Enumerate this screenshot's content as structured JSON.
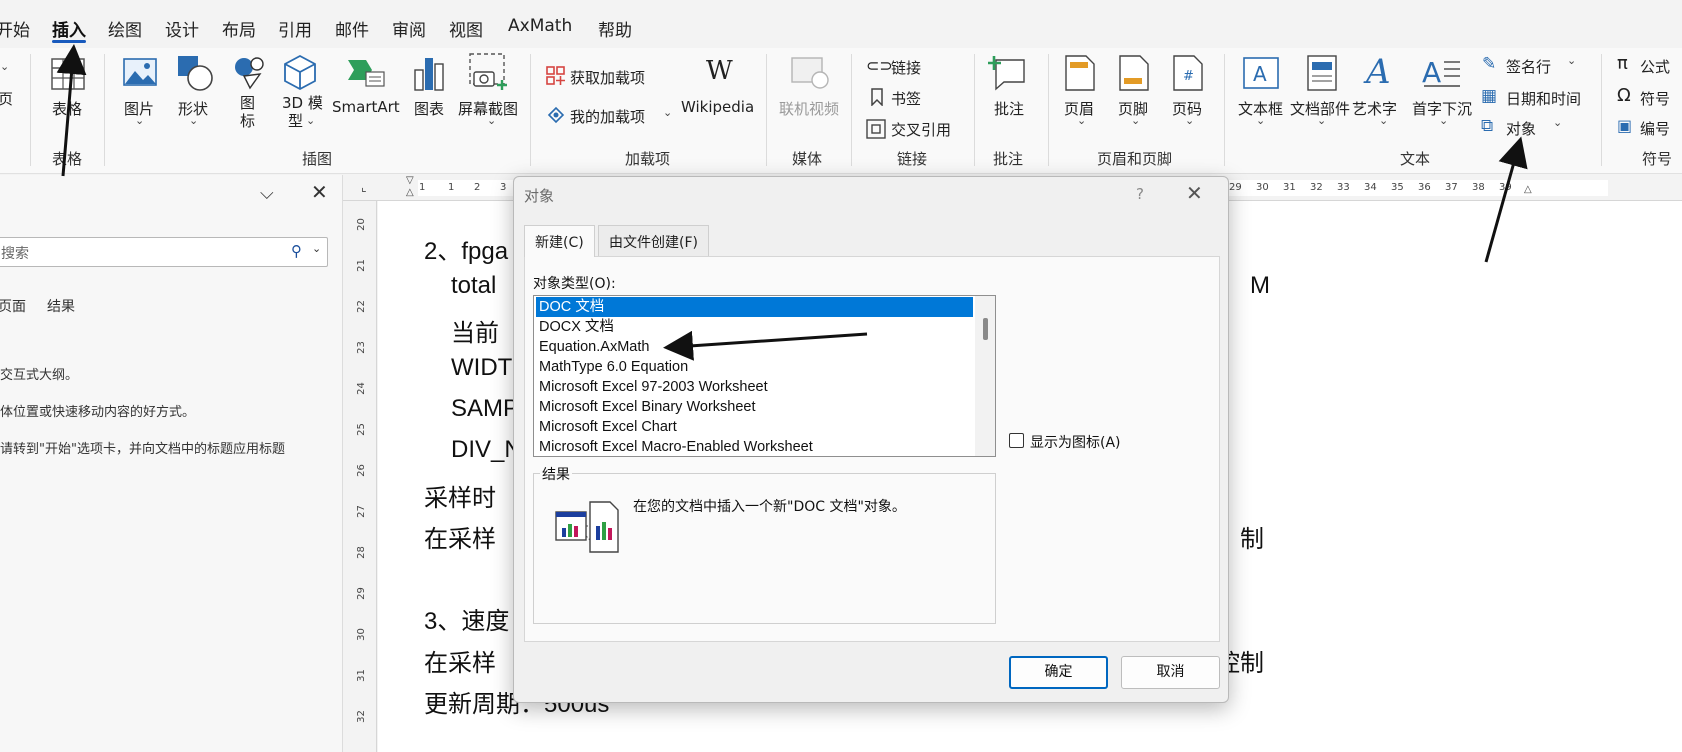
{
  "menu": {
    "tabs": [
      {
        "label": "开始"
      },
      {
        "label": "插入",
        "active": true
      },
      {
        "label": "绘图"
      },
      {
        "label": "设计"
      },
      {
        "label": "布局"
      },
      {
        "label": "引用"
      },
      {
        "label": "邮件"
      },
      {
        "label": "审阅"
      },
      {
        "label": "视图"
      },
      {
        "label": "AxMath"
      },
      {
        "label": "帮助"
      }
    ]
  },
  "ribbon": {
    "left_cut_label": "页",
    "groups": {
      "tables": {
        "label": "表格",
        "table_button": "表格"
      },
      "illustrations": {
        "label": "插图",
        "picture": "图片",
        "shapes": "形状",
        "icons_line1": "图",
        "icons_line2": "标",
        "model3d_line1": "3D 模",
        "model3d_line2": "型",
        "smartart": "SmartArt",
        "chart": "图表",
        "screenshot": "屏幕截图"
      },
      "addins": {
        "label": "加载项",
        "get_addins": "获取加载项",
        "my_addins": "我的加载项",
        "wikipedia": "Wikipedia"
      },
      "media": {
        "label": "媒体",
        "online_video": "联机视频"
      },
      "links": {
        "label": "链接",
        "link": "链接",
        "bookmark": "书签",
        "cross_reference": "交叉引用"
      },
      "comments": {
        "label": "批注",
        "comment": "批注"
      },
      "header_footer": {
        "label": "页眉和页脚",
        "header": "页眉",
        "footer": "页脚",
        "page_number": "页码"
      },
      "text": {
        "label": "文本",
        "textbox": "文本框",
        "quick_parts": "文档部件",
        "wordart": "艺术字",
        "drop_cap": "首字下沉",
        "signature_line": "签名行",
        "date_time": "日期和时间",
        "object": "对象"
      },
      "symbols": {
        "label": "符号",
        "equation": "公式",
        "symbol": "符号",
        "number": "编号"
      }
    }
  },
  "nav_pane": {
    "search_placeholder": "搜索",
    "tabs": [
      "页面",
      "结果"
    ],
    "hints": [
      "交互式大纲。",
      "体位置或快速移动内容的好方式。",
      "请转到\"开始\"选项卡，并向文档中的标题应用标题"
    ]
  },
  "ruler": {
    "top_numbers": [
      "1",
      "1",
      "2",
      "3",
      "29",
      "30",
      "31",
      "32",
      "33",
      "34",
      "35",
      "36",
      "37",
      "38",
      "39"
    ],
    "left_numbers": [
      "20",
      "21",
      "22",
      "23",
      "24",
      "25",
      "26",
      "27",
      "28",
      "29",
      "30",
      "31",
      "32"
    ]
  },
  "document": {
    "lines": [
      "2、fpga",
      "total",
      "当前",
      "WIDT",
      "SAMP",
      "DIV_N",
      "采样时",
      "在采样",
      "3、速度",
      "在采样",
      "更新周期：500us"
    ],
    "right_fragments": [
      "M",
      "制",
      "控制"
    ]
  },
  "dialog": {
    "title": "对象",
    "help": "?",
    "tabs": [
      "新建(C)",
      "由文件创建(F)"
    ],
    "object_type_label": "对象类型(O):",
    "object_types": [
      "DOC 文档",
      "DOCX 文档",
      "Equation.AxMath",
      "MathType 6.0 Equation",
      "Microsoft Excel 97-2003 Worksheet",
      "Microsoft Excel Binary Worksheet",
      "Microsoft Excel Chart",
      "Microsoft Excel Macro-Enabled Worksheet"
    ],
    "selected_index": 0,
    "display_as_icon": "显示为图标(A)",
    "display_as_icon_checked": false,
    "result_label": "结果",
    "result_text": "在您的文档中插入一个新\"DOC 文档\"对象。",
    "ok": "确定",
    "cancel": "取消"
  },
  "colors": {
    "accent": "#185abd",
    "selection": "#0078d7",
    "primary_button_border": "#0067c0"
  }
}
